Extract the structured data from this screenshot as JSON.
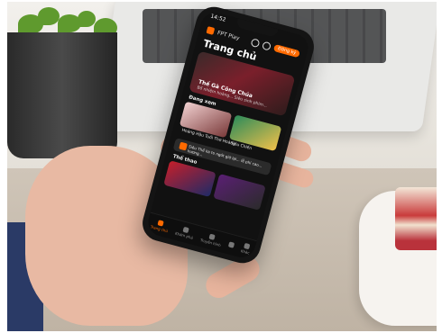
{
  "app": {
    "brand": "FPT Play",
    "status_time": "14:52",
    "page_title": "Trang chủ",
    "cta_button": "Đăng ký"
  },
  "hero": {
    "title": "Thế Gà Công Chúa",
    "subtitle": "Bổ nhiệm hoàng... Siêu sinh phim..."
  },
  "sections": {
    "trending": "Đang xem",
    "sports": "Thể thao"
  },
  "cards": {
    "row1": [
      {
        "caption": "Hoàng Hậu Tuổi Thơ Hoàng"
      },
      {
        "caption": "Siêu Chiến"
      }
    ],
    "row2": [
      {
        "caption": ""
      },
      {
        "caption": ""
      }
    ]
  },
  "banner": {
    "text": "Siêu Thể ka to ngót giờ lại... lễ phí cao... hương..."
  },
  "bottom_nav": [
    {
      "label": "Trang chủ",
      "active": true
    },
    {
      "label": "Khám phá",
      "active": false
    },
    {
      "label": "Truyền hình",
      "active": false
    },
    {
      "label": "",
      "active": false
    },
    {
      "label": "Khác",
      "active": false
    }
  ],
  "colors": {
    "accent": "#ff6a00",
    "screen_bg": "#111111"
  },
  "icons": [
    "search-icon",
    "bell-icon",
    "home-icon",
    "compass-icon",
    "tv-icon",
    "grid-icon",
    "more-icon"
  ]
}
